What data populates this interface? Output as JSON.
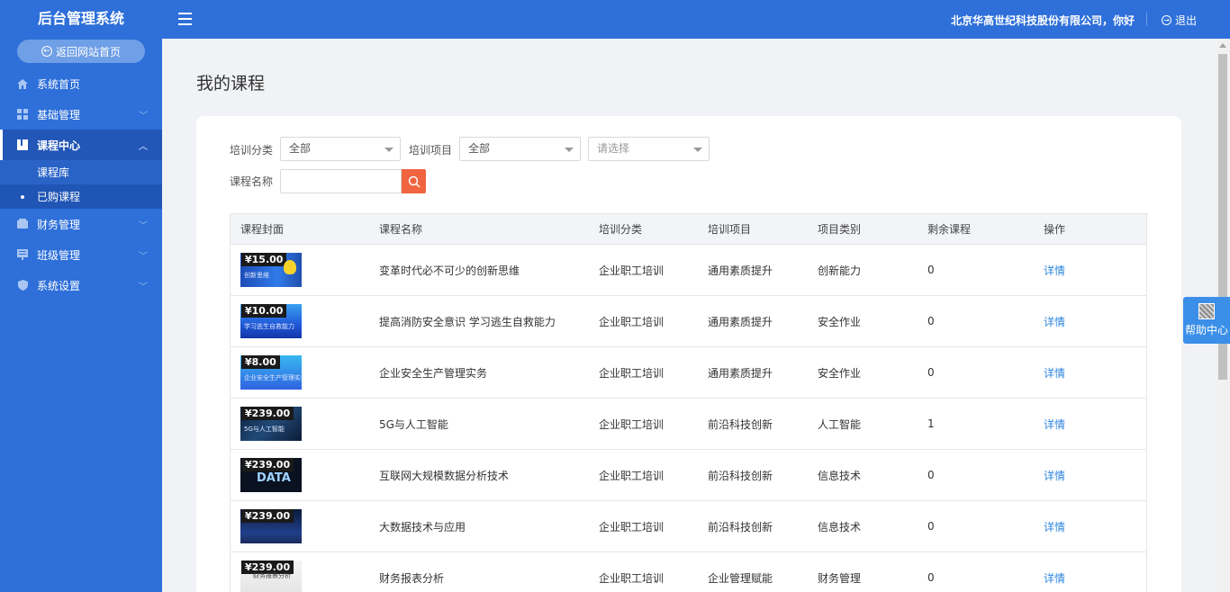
{
  "sidebar": {
    "brand": "后台管理系统",
    "back_home": "返回网站首页",
    "items": [
      {
        "label": "系统首页",
        "icon": "home-icon"
      },
      {
        "label": "基础管理",
        "icon": "grid-icon"
      },
      {
        "label": "课程中心",
        "icon": "book-icon",
        "active": true,
        "children": [
          {
            "label": "课程库"
          },
          {
            "label": "已购课程",
            "active": true
          }
        ]
      },
      {
        "label": "财务管理",
        "icon": "wallet-icon"
      },
      {
        "label": "班级管理",
        "icon": "class-icon"
      },
      {
        "label": "系统设置",
        "icon": "shield-icon"
      }
    ]
  },
  "topbar": {
    "greeting": "北京华高世纪科技股份有限公司，你好",
    "logout": "退出"
  },
  "page": {
    "title": "我的课程"
  },
  "filters": {
    "category_label": "培训分类",
    "category_value": "全部",
    "project_label": "培训项目",
    "project_value": "全部",
    "project_sub_placeholder": "请选择",
    "name_label": "课程名称",
    "name_value": ""
  },
  "table": {
    "headers": [
      "课程封面",
      "课程名称",
      "培训分类",
      "培训项目",
      "项目类别",
      "剩余课程",
      "操作"
    ],
    "rows": [
      {
        "price": "¥15.00",
        "cover_caption": "创新思维",
        "name": "变革时代必不可少的创新思维",
        "category": "企业职工培训",
        "project": "通用素质提升",
        "type": "创新能力",
        "remaining": "0",
        "action": "详情"
      },
      {
        "price": "¥10.00",
        "cover_caption": "学习逃生自救能力",
        "name": "提高消防安全意识 学习逃生自救能力",
        "category": "企业职工培训",
        "project": "通用素质提升",
        "type": "安全作业",
        "remaining": "0",
        "action": "详情"
      },
      {
        "price": "¥8.00",
        "cover_caption": "企业安全生产管理实务",
        "name": "企业安全生产管理实务",
        "category": "企业职工培训",
        "project": "通用素质提升",
        "type": "安全作业",
        "remaining": "0",
        "action": "详情"
      },
      {
        "price": "¥239.00",
        "cover_caption": "5G与人工智能",
        "name": "5G与人工智能",
        "category": "企业职工培训",
        "project": "前沿科技创新",
        "type": "人工智能",
        "remaining": "1",
        "action": "详情"
      },
      {
        "price": "¥239.00",
        "cover_caption": "DATA",
        "name": "互联网大规模数据分析技术",
        "category": "企业职工培训",
        "project": "前沿科技创新",
        "type": "信息技术",
        "remaining": "0",
        "action": "详情"
      },
      {
        "price": "¥239.00",
        "cover_caption": "",
        "name": "大数据技术与应用",
        "category": "企业职工培训",
        "project": "前沿科技创新",
        "type": "信息技术",
        "remaining": "0",
        "action": "详情"
      },
      {
        "price": "¥239.00",
        "cover_caption": "财务报表分析",
        "name": "财务报表分析",
        "category": "企业职工培训",
        "project": "企业管理赋能",
        "type": "财务管理",
        "remaining": "0",
        "action": "详情"
      }
    ]
  },
  "help": {
    "label": "帮助中心"
  },
  "colors": {
    "primary": "#2e6fd9",
    "link": "#2e86de",
    "search_button": "#f0643f"
  }
}
